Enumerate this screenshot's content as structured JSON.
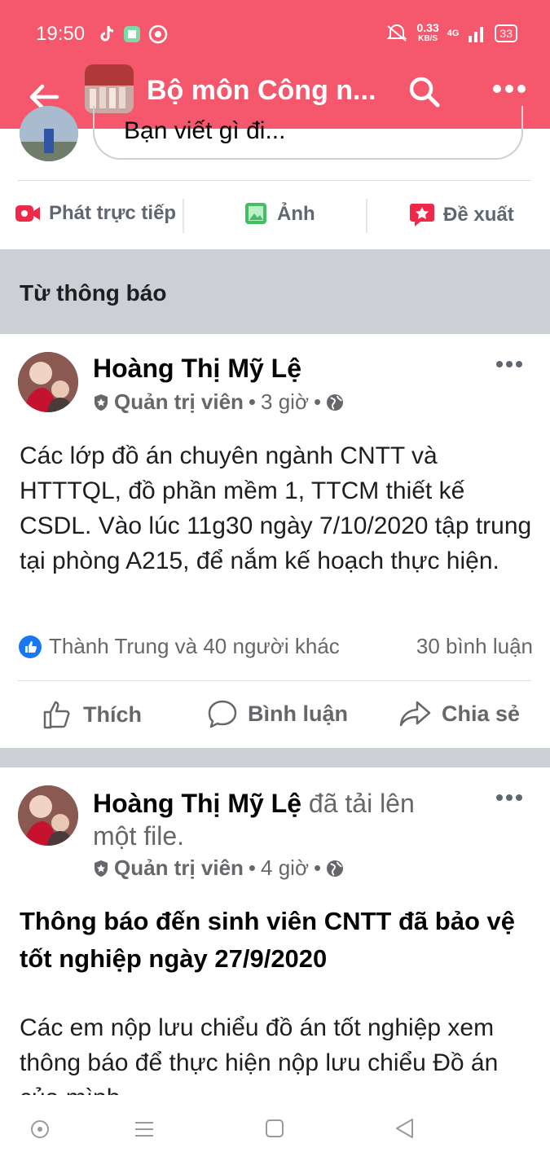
{
  "status": {
    "time": "19:50",
    "speed": "0.33",
    "speed_unit": "KB/S",
    "battery": "33",
    "network": "4G"
  },
  "header": {
    "title": "Bộ môn Công n..."
  },
  "composer": {
    "placeholder": "Bạn viết gì đi..."
  },
  "actions": [
    {
      "label": "Phát trực tiếp",
      "icon": "live-video-icon"
    },
    {
      "label": "Ảnh",
      "icon": "photo-icon"
    },
    {
      "label": "Đề xuất",
      "icon": "suggest-icon"
    }
  ],
  "section": {
    "title": "Từ thông báo"
  },
  "posts": [
    {
      "author": "Hoàng Thị Mỹ Lệ",
      "role": "Quản trị viên",
      "time": "3 giờ",
      "text": "Các lớp đồ án chuyên ngành CNTT và HTTTQL, đồ  phần mềm 1, TTCM thiết kế CSDL. Vào lúc 11g30 ngày 7/10/2020 tập trung tại phòng A215,  để nắm kế hoạch thực hiện.",
      "reactions": "Thành Trung và 40 người khác",
      "comments": "30 bình luận"
    },
    {
      "author": "Hoàng Thị Mỹ Lệ",
      "extra_line1": " đã tải lên",
      "extra_line2": "một file.",
      "role": "Quản trị viên",
      "time": "4 giờ",
      "title": "Thông báo đến sinh viên CNTT đã bảo vệ tốt nghiệp ngày 27/9/2020",
      "text": "Các em nộp lưu chiểu đồ án tốt nghiệp xem thông báo để thực hiện nộp lưu chiểu Đồ án của mình"
    }
  ],
  "buttons": {
    "like": "Thích",
    "comment": "Bình luận",
    "share": "Chia sẻ"
  },
  "colors": {
    "brand": "#f5576c",
    "like_blue": "#1877f2",
    "live_red": "#f02849",
    "photo_green": "#45bd62"
  }
}
